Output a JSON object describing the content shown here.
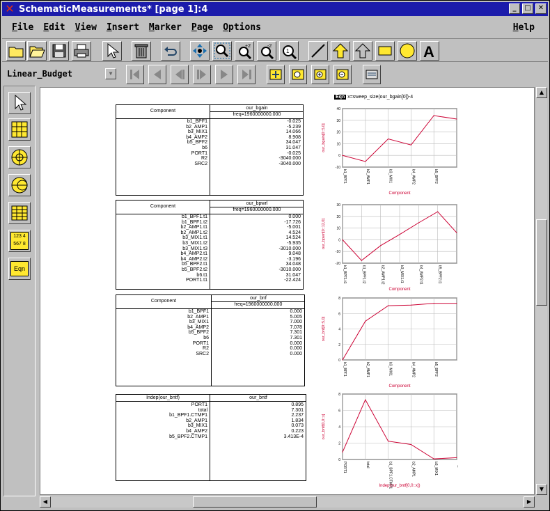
{
  "window": {
    "title": "SchematicMeasurements* [page 1]:4"
  },
  "menu": [
    {
      "label": "File",
      "ul": "F",
      "rest": "ile"
    },
    {
      "label": "Edit",
      "ul": "E",
      "rest": "dit"
    },
    {
      "label": "View",
      "ul": "V",
      "rest": "iew"
    },
    {
      "label": "Insert",
      "ul": "I",
      "rest": "nsert"
    },
    {
      "label": "Marker",
      "ul": "M",
      "rest": "arker"
    },
    {
      "label": "Page",
      "ul": "P",
      "rest": "age"
    },
    {
      "label": "Options",
      "ul": "O",
      "rest": "ptions"
    }
  ],
  "help": {
    "ul": "H",
    "rest": "elp"
  },
  "toolbar2": {
    "combo_value": "Linear_Budget"
  },
  "palette": {
    "eqn_label": "Eqn",
    "numbers_label_1": "123 4",
    "numbers_label_2": "567 8"
  },
  "equation": {
    "tag": "Eqn",
    "text": "x=sweep_size(our_bgain[0])-4"
  },
  "tables": [
    {
      "col1_header": "Component",
      "col2_header": "our_bgain",
      "col2_sub": "freq=1960000000.000",
      "names": [
        "b1_BPF1",
        "b2_AMP1",
        "b3_MIX1",
        "b4_AMP2",
        "b5_BPF2",
        "b6",
        "PORT1",
        "R2",
        "SRC2"
      ],
      "values": [
        "-0.025",
        "-5.239",
        "14.066",
        "8.908",
        "34.047",
        "31.047",
        "-0.025",
        "-3040.000",
        "-3040.000"
      ]
    },
    {
      "col1_header": "Component",
      "col2_header": "our_bpwrl",
      "col2_sub": "freq=1960000000.000",
      "names": [
        "b1_BPF1.t1",
        "b1_BPF1.t2",
        "b2_AMP1.t1",
        "b2_AMP1.t2",
        "b3_MIX1.t1",
        "b3_MIX1.t2",
        "b3_MIX1.t3",
        "b4_AMP2.t1",
        "b4_AMP2.t2",
        "b5_BPF2.t1",
        "b5_BPF2.t2",
        "b6.t1",
        "PORT1.t1"
      ],
      "values": [
        "0.000",
        "-17.726",
        "-5.001",
        "4.524",
        "14.524",
        "-5.935",
        "-3010.000",
        "9.048",
        "-3.196",
        "34.048",
        "-3010.000",
        "31.047",
        "-22.424"
      ]
    },
    {
      "col1_header": "Component",
      "col2_header": "our_bnf",
      "col2_sub": "freq=1960000000.000",
      "names": [
        "b1_BPF1",
        "b2_AMP1",
        "b3_MIX1",
        "b4_AMP2",
        "b5_BPF2",
        "b6",
        "PORT1",
        "R2",
        "SRC2"
      ],
      "values": [
        "0.000",
        "5.005",
        "7.000",
        "7.078",
        "7.301",
        "7.301",
        "0.000",
        "0.000",
        "0.000"
      ]
    },
    {
      "col1_header": "Indep(our_bntf)",
      "col2_header": "our_bntf",
      "col2_sub": "",
      "names": [
        "PORT1",
        "total",
        "b1_BPF1.CTMP1",
        "b2_AMP1",
        "b3_MIX1",
        "b4_AMP2",
        "b5_BPF2.CTMP1"
      ],
      "values": [
        "0.895",
        "7.301",
        "2.237",
        "1.834",
        "0.073",
        "0.223",
        "3.413E-4"
      ]
    }
  ],
  "chart_data": [
    {
      "type": "line",
      "x": [
        "b1_BPF1",
        "b2_AMP1",
        "b3_MIX1",
        "b4_AMP2",
        "b5_BPF2",
        "b6"
      ],
      "series": [
        {
          "values": [
            -0.025,
            -5.239,
            14.066,
            8.908,
            34.047,
            31.047
          ]
        }
      ],
      "ylabel": "our_bgain[0::5,0]",
      "xlabel": "Component",
      "ylim": [
        -10,
        40
      ],
      "yticks": [
        40,
        30,
        20,
        10,
        0,
        -10
      ],
      "color": "#cc0033"
    },
    {
      "type": "line",
      "x": [
        "b1_BPF1.t1",
        "b1_BPF1.t2",
        "b2_AMP1.t2",
        "b3_MIX1.t1",
        "b4_AMP2.t1",
        "b5_BPF2.t1",
        "b6.t1"
      ],
      "series": [
        {
          "values": [
            0.0,
            -17.726,
            -5.001,
            4.524,
            14.524,
            24.0,
            6.0
          ]
        }
      ],
      "ylabel": "our_bpwrl[0::12,0]",
      "xlabel": "Component",
      "ylim": [
        -20,
        30
      ],
      "yticks": [
        30,
        20,
        10,
        0,
        -10,
        -20
      ],
      "color": "#cc0033"
    },
    {
      "type": "line",
      "x": [
        "b1_BPF1",
        "b2_AMP1",
        "b3_MIX1",
        "b4_AMP2",
        "b5_BPF2",
        "b6"
      ],
      "series": [
        {
          "values": [
            0.0,
            5.005,
            7.0,
            7.078,
            7.301,
            7.301
          ]
        }
      ],
      "ylabel": "our_bnf[0::5,0]",
      "xlabel": "Component",
      "ylim": [
        0,
        8
      ],
      "yticks": [
        8,
        6,
        4,
        2,
        0
      ],
      "color": "#cc0033"
    },
    {
      "type": "line",
      "x": [
        "PORT1",
        "total",
        "b1_BPF1.CTMP1",
        "b2_AMP1",
        "b3_MIX1",
        "b4_AMP2"
      ],
      "series": [
        {
          "values": [
            0.895,
            7.301,
            2.237,
            1.834,
            0.073,
            0.223
          ]
        }
      ],
      "ylabel": "our_bntf[0,0::x]",
      "xlabel": "Indep(our_bntf[0,0::x])",
      "ylim": [
        0,
        8
      ],
      "yticks": [
        8,
        6,
        4,
        2,
        0
      ],
      "color": "#cc0033"
    }
  ]
}
